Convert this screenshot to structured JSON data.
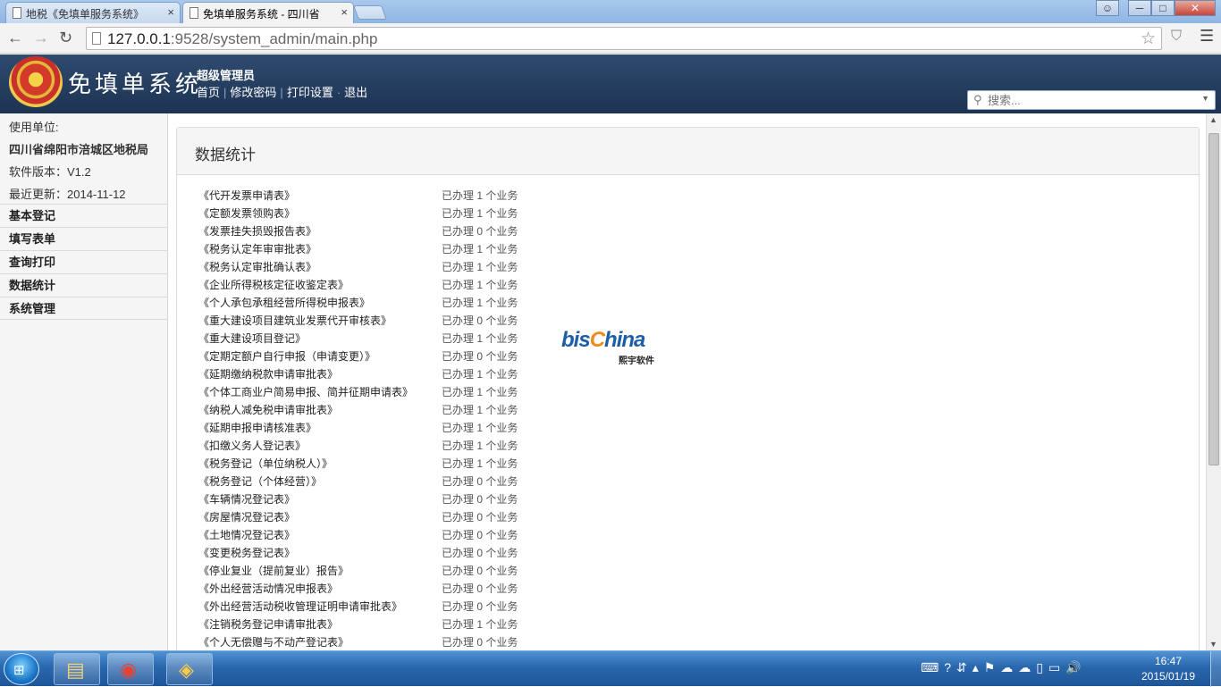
{
  "browser": {
    "tabs": [
      {
        "label": "地税《免填单服务系统》",
        "active": false
      },
      {
        "label": "免填单服务系统 - 四川省",
        "active": true
      }
    ],
    "close_glyph": "×",
    "url_host": "127.0.0.1",
    "url_rest": ":9528/system_admin/main.php",
    "window_buttons": {
      "minimize": "─",
      "maximize": "□",
      "close": "✕"
    }
  },
  "header": {
    "app_title": "免填单系统",
    "admin_name": "超级管理员",
    "nav": [
      "首页",
      "修改密码",
      "打印设置",
      "退出"
    ],
    "search_placeholder": "搜索..."
  },
  "sidebar": {
    "unit_label": "使用单位:",
    "unit_name": "四川省绵阳市涪城区地税局",
    "version": "软件版本：V1.2",
    "updated": "最近更新：2014-11-12",
    "menu": [
      "基本登记",
      "填写表单",
      "查询打印",
      "数据统计",
      "系统管理"
    ]
  },
  "main": {
    "title": "数据统计",
    "stats": [
      {
        "form": "《代开发票申请表》",
        "status": "已办理 1 个业务"
      },
      {
        "form": "《定额发票领购表》",
        "status": "已办理 1 个业务"
      },
      {
        "form": "《发票挂失损毁报告表》",
        "status": "已办理 0 个业务"
      },
      {
        "form": "《税务认定年审审批表》",
        "status": "已办理 1 个业务"
      },
      {
        "form": "《税务认定审批确认表》",
        "status": "已办理 1 个业务"
      },
      {
        "form": "《企业所得税核定征收鉴定表》",
        "status": "已办理 1 个业务"
      },
      {
        "form": "《个人承包承租经营所得税申报表》",
        "status": "已办理 1 个业务"
      },
      {
        "form": "《重大建设项目建筑业发票代开审核表》",
        "status": "已办理 0 个业务"
      },
      {
        "form": "《重大建设项目登记》",
        "status": "已办理 1 个业务"
      },
      {
        "form": "《定期定额户自行申报（申请变更）》",
        "status": "已办理 0 个业务"
      },
      {
        "form": "《延期缴纳税款申请审批表》",
        "status": "已办理 1 个业务"
      },
      {
        "form": "《个体工商业户简易申报、简并征期申请表》",
        "status": "已办理 1 个业务"
      },
      {
        "form": "《纳税人减免税申请审批表》",
        "status": "已办理 1 个业务"
      },
      {
        "form": "《延期申报申请核准表》",
        "status": "已办理 1 个业务"
      },
      {
        "form": "《扣缴义务人登记表》",
        "status": "已办理 1 个业务"
      },
      {
        "form": "《税务登记（单位纳税人）》",
        "status": "已办理 1 个业务"
      },
      {
        "form": "《税务登记（个体经营）》",
        "status": "已办理 0 个业务"
      },
      {
        "form": "《车辆情况登记表》",
        "status": "已办理 0 个业务"
      },
      {
        "form": "《房屋情况登记表》",
        "status": "已办理 0 个业务"
      },
      {
        "form": "《土地情况登记表》",
        "status": "已办理 0 个业务"
      },
      {
        "form": "《变更税务登记表》",
        "status": "已办理 0 个业务"
      },
      {
        "form": "《停业复业（提前复业）报告》",
        "status": "已办理 0 个业务"
      },
      {
        "form": "《外出经营活动情况申报表》",
        "status": "已办理 0 个业务"
      },
      {
        "form": "《外出经营活动税收管理证明申请审批表》",
        "status": "已办理 0 个业务"
      },
      {
        "form": "《注销税务登记申请审批表》",
        "status": "已办理 1 个业务"
      },
      {
        "form": "《个人无偿赠与不动产登记表》",
        "status": "已办理 0 个业务"
      }
    ],
    "logo_text_a": "bis",
    "logo_text_b": "hina",
    "logo_sub": "熙宇软件"
  },
  "taskbar": {
    "time": "16:47",
    "date": "2015/01/19"
  }
}
